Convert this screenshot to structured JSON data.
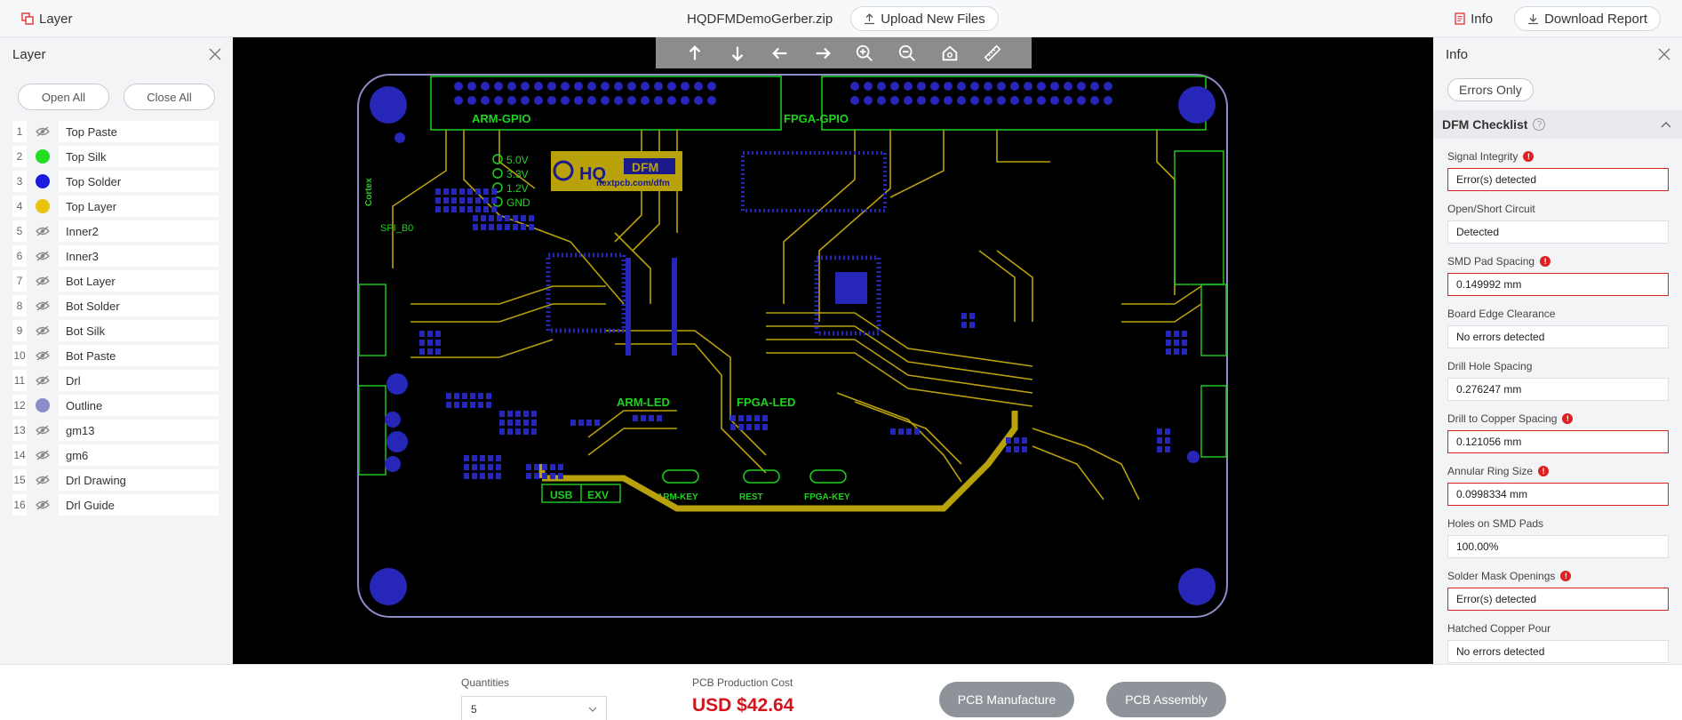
{
  "header": {
    "layer_title": "Layer",
    "filename": "HQDFMDemoGerber.zip",
    "upload_label": "Upload New Files",
    "info_label": "Info",
    "download_label": "Download Report"
  },
  "left_panel": {
    "title": "Layer",
    "open_all": "Open All",
    "close_all": "Close All",
    "layers": [
      {
        "num": "1",
        "name": "Top Paste",
        "vis": "hidden"
      },
      {
        "num": "2",
        "name": "Top Silk",
        "vis": "color",
        "color": "#22dd22"
      },
      {
        "num": "3",
        "name": "Top Solder",
        "vis": "color",
        "color": "#1a1add"
      },
      {
        "num": "4",
        "name": "Top Layer",
        "vis": "color",
        "color": "#e8c20c"
      },
      {
        "num": "5",
        "name": "Inner2",
        "vis": "hidden"
      },
      {
        "num": "6",
        "name": "Inner3",
        "vis": "hidden"
      },
      {
        "num": "7",
        "name": "Bot Layer",
        "vis": "hidden"
      },
      {
        "num": "8",
        "name": "Bot Solder",
        "vis": "hidden"
      },
      {
        "num": "9",
        "name": "Bot Silk",
        "vis": "hidden"
      },
      {
        "num": "10",
        "name": "Bot Paste",
        "vis": "hidden"
      },
      {
        "num": "11",
        "name": "Drl",
        "vis": "hidden"
      },
      {
        "num": "12",
        "name": "Outline",
        "vis": "color",
        "color": "#8c8cc8"
      },
      {
        "num": "13",
        "name": "gm13",
        "vis": "hidden"
      },
      {
        "num": "14",
        "name": "gm6",
        "vis": "hidden"
      },
      {
        "num": "15",
        "name": "Drl Drawing",
        "vis": "hidden"
      },
      {
        "num": "16",
        "name": "Drl Guide",
        "vis": "hidden"
      }
    ]
  },
  "viewer": {
    "tools": [
      "arrow-up-icon",
      "arrow-down-icon",
      "arrow-left-icon",
      "arrow-right-icon",
      "zoom-in-icon",
      "zoom-out-icon",
      "home-icon",
      "ruler-icon"
    ],
    "board": {
      "labels": {
        "arm_gpio": "ARM-GPIO",
        "fpga_gpio": "FPGA-GPIO",
        "v50": "5.0V",
        "v33": "3.3V",
        "v12": "1.2V",
        "gnd": "GND",
        "spi": "SPI_B0",
        "arm_led": "ARM-LED",
        "fpga_led": "FPGA-LED",
        "usb": "USB",
        "exv": "EXV",
        "arm_key": "ARM-KEY",
        "rest": "REST",
        "fpga_key": "FPGA-KEY",
        "cortex": "Cortex"
      },
      "logo": {
        "hq": "HQ",
        "dfm": "DFM",
        "url": "nextpcb.com/dfm"
      }
    }
  },
  "right_panel": {
    "title": "Info",
    "errors_only": "Errors Only",
    "checklist_title": "DFM Checklist",
    "checks": [
      {
        "label": "Signal Integrity",
        "value": "Error(s) detected",
        "error": true
      },
      {
        "label": "Open/Short Circuit",
        "value": "Detected",
        "error": false
      },
      {
        "label": "SMD Pad Spacing",
        "value": "0.149992 mm",
        "error": true
      },
      {
        "label": "Board Edge Clearance",
        "value": "No errors detected",
        "error": false
      },
      {
        "label": "Drill Hole Spacing",
        "value": "0.276247 mm",
        "error": false
      },
      {
        "label": "Drill to Copper Spacing",
        "value": "0.121056 mm",
        "error": true
      },
      {
        "label": "Annular Ring Size",
        "value": "0.0998334 mm",
        "error": true
      },
      {
        "label": "Holes on SMD Pads",
        "value": "100.00%",
        "error": false
      },
      {
        "label": "Solder Mask Openings",
        "value": "Error(s) detected",
        "error": true
      },
      {
        "label": "Hatched Copper Pour",
        "value": "No errors detected",
        "error": false
      }
    ]
  },
  "bottom": {
    "quantities_label": "Quantities",
    "quantity_value": "5",
    "cost_label": "PCB Production Cost",
    "cost_value": "USD $42.64",
    "manufacture": "PCB Manufacture",
    "assembly": "PCB Assembly"
  },
  "colors": {
    "pcb_copper": "#b9a10a",
    "pcb_silk": "#1fd21f",
    "pcb_pad": "#2626b8",
    "pcb_outline": "#8c8cc8",
    "error_red": "#e02020",
    "cost_red": "#d4141c",
    "action_gray": "#8e9299"
  }
}
